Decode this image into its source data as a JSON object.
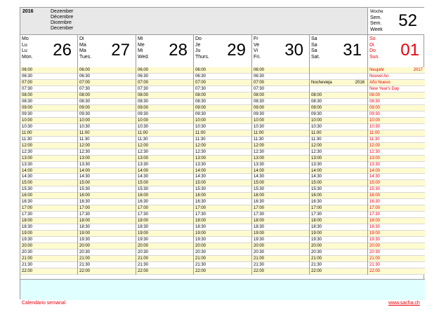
{
  "header": {
    "year": "2016",
    "months": [
      "Dezember",
      "Décembre",
      "Dicembre",
      "December"
    ],
    "week_labels": [
      "Woche",
      "Sem.",
      "Sem.",
      "Week"
    ],
    "week_number": "52"
  },
  "days": [
    {
      "names": [
        "Mo",
        "Lu",
        "Lu",
        "Mon."
      ],
      "number": "26",
      "color": "#000000"
    },
    {
      "names": [
        "Di",
        "Ma",
        "Ma",
        "Tues."
      ],
      "number": "27",
      "color": "#000000"
    },
    {
      "names": [
        "Mi",
        "Me",
        "Mi",
        "Wed."
      ],
      "number": "28",
      "color": "#000000"
    },
    {
      "names": [
        "Do",
        "Je",
        "Ju",
        "Thurs."
      ],
      "number": "29",
      "color": "#000000"
    },
    {
      "names": [
        "Fr",
        "Ve",
        "Vi",
        "Fri."
      ],
      "number": "30",
      "color": "#000000"
    },
    {
      "names": [
        "Sa",
        "Sa",
        "Sa",
        "Sat."
      ],
      "number": "31",
      "color": "#000000"
    },
    {
      "names": [
        "So",
        "Di",
        "Do",
        "Sun."
      ],
      "number": "01",
      "color": "#e8000b"
    }
  ],
  "times": [
    "06:00",
    "06:30",
    "07:00",
    "07:30",
    "08:00",
    "08:30",
    "09:00",
    "09:30",
    "10:00",
    "10:30",
    "11:00",
    "11:30",
    "12:00",
    "12:30",
    "13:00",
    "13:30",
    "14:00",
    "14:30",
    "15:00",
    "15:30",
    "16:00",
    "16:30",
    "17:00",
    "17:30",
    "18:00",
    "18:30",
    "19:00",
    "19:30",
    "20:00",
    "20:30",
    "21:00",
    "21:30",
    "22:00"
  ],
  "events": {
    "saturday": {
      "text": "Nochevieja",
      "year": "2016"
    },
    "sunday": {
      "lines": [
        "Neujahr",
        "Nouvel An",
        "Año Nuevo",
        "New Year's Day"
      ],
      "year": "2017"
    }
  },
  "footer": {
    "left": "Calendario semanal",
    "right": "www.sacha.ch"
  },
  "colors": {
    "holiday": "#e8000b",
    "row_shade": "#fffbd0",
    "notes_area": "#e0ffff",
    "header_bg": "#e8e8e8"
  }
}
